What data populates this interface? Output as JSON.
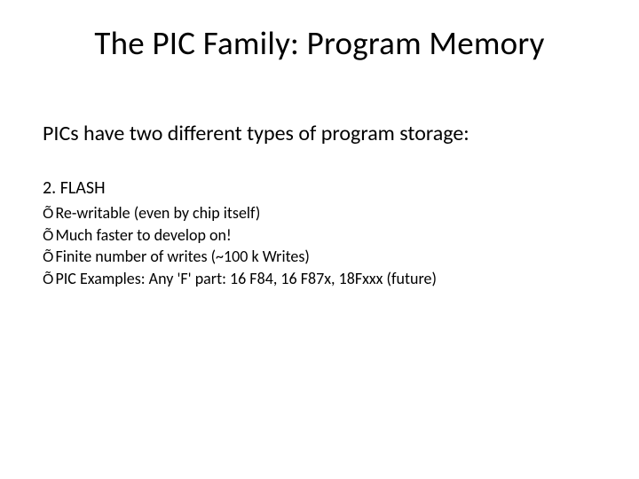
{
  "title": "The PIC Family: Program Memory",
  "subtitle": "PICs have two different types of program storage:",
  "section_heading": "2. FLASH",
  "bullet_glyph": "Õ",
  "bullets": [
    "Re-writable (even by chip itself)",
    "Much faster to develop on!",
    "Finite number of writes (~100 k Writes)",
    "PIC Examples: Any 'F' part: 16 F84, 16 F87x, 18Fxxx (future)"
  ]
}
